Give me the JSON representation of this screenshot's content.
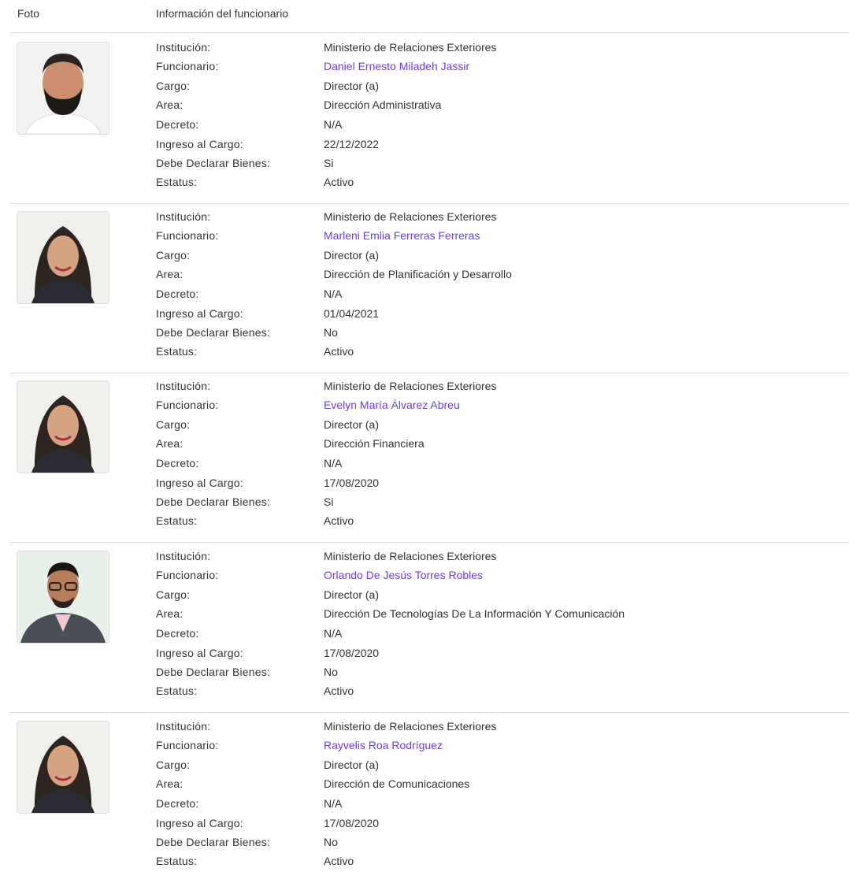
{
  "header": {
    "foto_label": "Foto",
    "info_label": "Información del funcionario"
  },
  "field_labels": {
    "institucion": "Institución:",
    "funcionario": "Funcionario:",
    "cargo": "Cargo:",
    "area": "Area:",
    "decreto": "Decreto:",
    "ingreso": "Ingreso al Cargo:",
    "declarar": "Debe Declarar Bienes:",
    "estatus": "Estatus:"
  },
  "colors": {
    "link": "#6a3ee0",
    "text": "#333333",
    "divider": "#dddddd"
  },
  "officials": [
    {
      "institucion": "Ministerio de Relaciones Exteriores",
      "funcionario": "Daniel Ernesto Miladeh Jassir",
      "cargo": "Director (a)",
      "area": "Dirección Administrativa",
      "decreto": "N/A",
      "ingreso": "22/12/2022",
      "declarar": "Si",
      "estatus": "Activo",
      "photo": "man-bearded-photo"
    },
    {
      "institucion": "Ministerio de Relaciones Exteriores",
      "funcionario": "Marleni Emlia Ferreras Ferreras",
      "cargo": "Director (a)",
      "area": "Dirección de Planificación y Desarrollo",
      "decreto": "N/A",
      "ingreso": "01/04/2021",
      "declarar": "No",
      "estatus": "Activo",
      "photo": "woman-photo"
    },
    {
      "institucion": "Ministerio de Relaciones Exteriores",
      "funcionario": "Evelyn María Álvarez Abreu",
      "cargo": "Director (a)",
      "area": "Dirección Financiera",
      "decreto": "N/A",
      "ingreso": "17/08/2020",
      "declarar": "Si",
      "estatus": "Activo",
      "photo": "woman-photo"
    },
    {
      "institucion": "Ministerio de Relaciones Exteriores",
      "funcionario": "Orlando De Jesús Torres Robles",
      "cargo": "Director (a)",
      "area": "Dirección De Tecnologías De La Información Y Comunicación",
      "decreto": "N/A",
      "ingreso": "17/08/2020",
      "declarar": "No",
      "estatus": "Activo",
      "photo": "man-glasses-photo"
    },
    {
      "institucion": "Ministerio de Relaciones Exteriores",
      "funcionario": "Rayvelis Roa Rodríguez",
      "cargo": "Director (a)",
      "area": "Dirección de Comunicaciones",
      "decreto": "N/A",
      "ingreso": "17/08/2020",
      "declarar": "No",
      "estatus": "Activo",
      "photo": "woman-photo"
    }
  ]
}
